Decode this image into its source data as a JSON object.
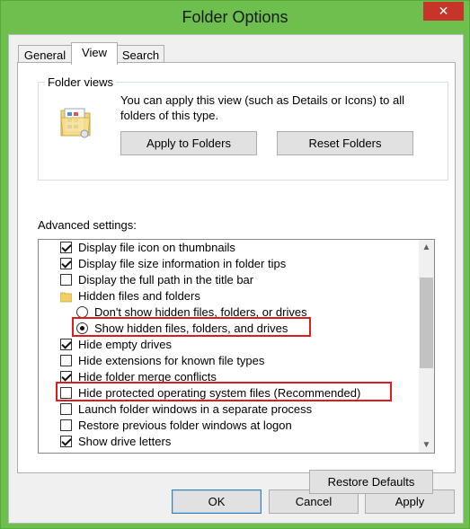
{
  "window": {
    "title": "Folder Options",
    "close_glyph": "✕"
  },
  "tabs": [
    {
      "label": "General"
    },
    {
      "label": "View"
    },
    {
      "label": "Search"
    }
  ],
  "folder_views": {
    "title": "Folder views",
    "description": "You can apply this view (such as Details or Icons) to all folders of this type.",
    "apply_label": "Apply to Folders",
    "reset_label": "Reset Folders"
  },
  "advanced": {
    "title": "Advanced settings:",
    "items": [
      {
        "label": "Display file icon on thumbnails",
        "type": "checkbox",
        "checked": true
      },
      {
        "label": "Display file size information in folder tips",
        "type": "checkbox",
        "checked": true
      },
      {
        "label": "Display the full path in the title bar",
        "type": "checkbox",
        "checked": false
      },
      {
        "label": "Hidden files and folders",
        "type": "folder"
      },
      {
        "label": "Don't show hidden files, folders, or drives",
        "type": "radio",
        "checked": false
      },
      {
        "label": "Show hidden files, folders, and drives",
        "type": "radio",
        "checked": true
      },
      {
        "label": "Hide empty drives",
        "type": "checkbox",
        "checked": true
      },
      {
        "label": "Hide extensions for known file types",
        "type": "checkbox",
        "checked": false
      },
      {
        "label": "Hide folder merge conflicts",
        "type": "checkbox",
        "checked": true
      },
      {
        "label": "Hide protected operating system files (Recommended)",
        "type": "checkbox",
        "checked": false
      },
      {
        "label": "Launch folder windows in a separate process",
        "type": "checkbox",
        "checked": false
      },
      {
        "label": "Restore previous folder windows at logon",
        "type": "checkbox",
        "checked": false
      },
      {
        "label": "Show drive letters",
        "type": "checkbox",
        "checked": true
      }
    ]
  },
  "buttons": {
    "restore_defaults": "Restore Defaults",
    "ok": "OK",
    "cancel": "Cancel",
    "apply": "Apply"
  },
  "colors": {
    "highlight": "#e01b1b",
    "frame": "#6dbf4e",
    "close": "#c7342a"
  }
}
